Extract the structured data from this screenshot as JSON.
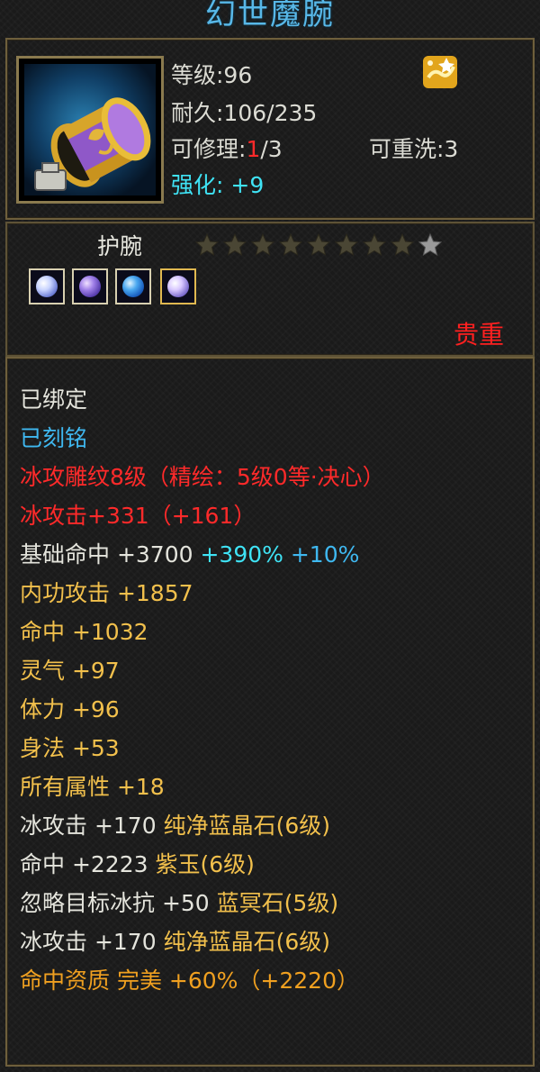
{
  "item": {
    "title": "幻世魔腕",
    "icon": "purple-golden-bracer-icon",
    "level": "等级:96",
    "durability": "耐久:106/235",
    "repair_prefix": "可修理:",
    "repair_current": "1",
    "repair_suffix": "/3",
    "rewash": "可重洗:3",
    "enhance_label": "强化:",
    "enhance_value": "+9",
    "slot": "护腕",
    "stars_filled": 8,
    "stars_total": 9,
    "sockets": [
      "blue-white-gem",
      "purple-gem",
      "blue-crystal-gem",
      "blue-white-gem"
    ],
    "precious": "贵重"
  },
  "attributes": [
    [
      {
        "text": "已绑定",
        "color": "white"
      }
    ],
    [
      {
        "text": "已刻铭",
        "color": "blue"
      }
    ],
    [
      {
        "text": "冰攻雕纹8级（精绘：5级0等·决心）",
        "color": "red"
      }
    ],
    [
      {
        "text": "冰攻击+331（+161）",
        "color": "red"
      }
    ],
    [
      {
        "text": "基础命中 +3700 ",
        "color": "white"
      },
      {
        "text": "+390% ",
        "color": "cyan"
      },
      {
        "text": "+10%",
        "color": "blue"
      }
    ],
    [
      {
        "text": "内功攻击 +1857",
        "color": "gold"
      }
    ],
    [
      {
        "text": "命中 +1032",
        "color": "gold"
      }
    ],
    [
      {
        "text": "灵气 +97",
        "color": "gold"
      }
    ],
    [
      {
        "text": "体力 +96",
        "color": "gold"
      }
    ],
    [
      {
        "text": "身法 +53",
        "color": "gold"
      }
    ],
    [
      {
        "text": "所有属性 +18",
        "color": "gold"
      }
    ],
    [
      {
        "text": "冰攻击 +170 ",
        "color": "white"
      },
      {
        "text": "纯净蓝晶石(6级)",
        "color": "gold"
      }
    ],
    [
      {
        "text": "命中 +2223 ",
        "color": "white"
      },
      {
        "text": "紫玉(6级)",
        "color": "gold"
      }
    ],
    [
      {
        "text": "忽略目标冰抗 +50 ",
        "color": "white"
      },
      {
        "text": "蓝冥石(5级)",
        "color": "gold"
      }
    ],
    [
      {
        "text": "冰攻击 +170 ",
        "color": "white"
      },
      {
        "text": "纯净蓝晶石(6级)",
        "color": "gold"
      }
    ],
    [
      {
        "text": "命中资质  完美 +60%（+2220）",
        "color": "orange"
      }
    ]
  ]
}
